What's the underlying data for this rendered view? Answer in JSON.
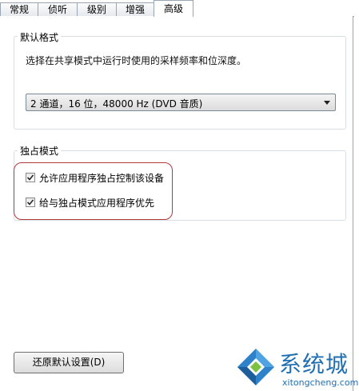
{
  "tabs": [
    {
      "label": "常规"
    },
    {
      "label": "侦听"
    },
    {
      "label": "级别"
    },
    {
      "label": "增强"
    },
    {
      "label": "高级"
    }
  ],
  "default_format": {
    "legend": "默认格式",
    "description": "选择在共享模式中运行时使用的采样频率和位深度。",
    "selected_value": "2 通道，16 位，48000 Hz (DVD 音质)"
  },
  "exclusive_mode": {
    "legend": "独占模式",
    "options": [
      {
        "label": "允许应用程序独占控制该设备",
        "checked": true
      },
      {
        "label": "给与独占模式应用程序优先",
        "checked": true
      }
    ]
  },
  "footer": {
    "restore_button": "还原默认设置(D)"
  },
  "watermark": {
    "brand": "系统城",
    "url": "xitongcheng.com"
  },
  "colors": {
    "highlight_border": "#b23a3a",
    "watermark_blue": "#1f6fb2"
  }
}
